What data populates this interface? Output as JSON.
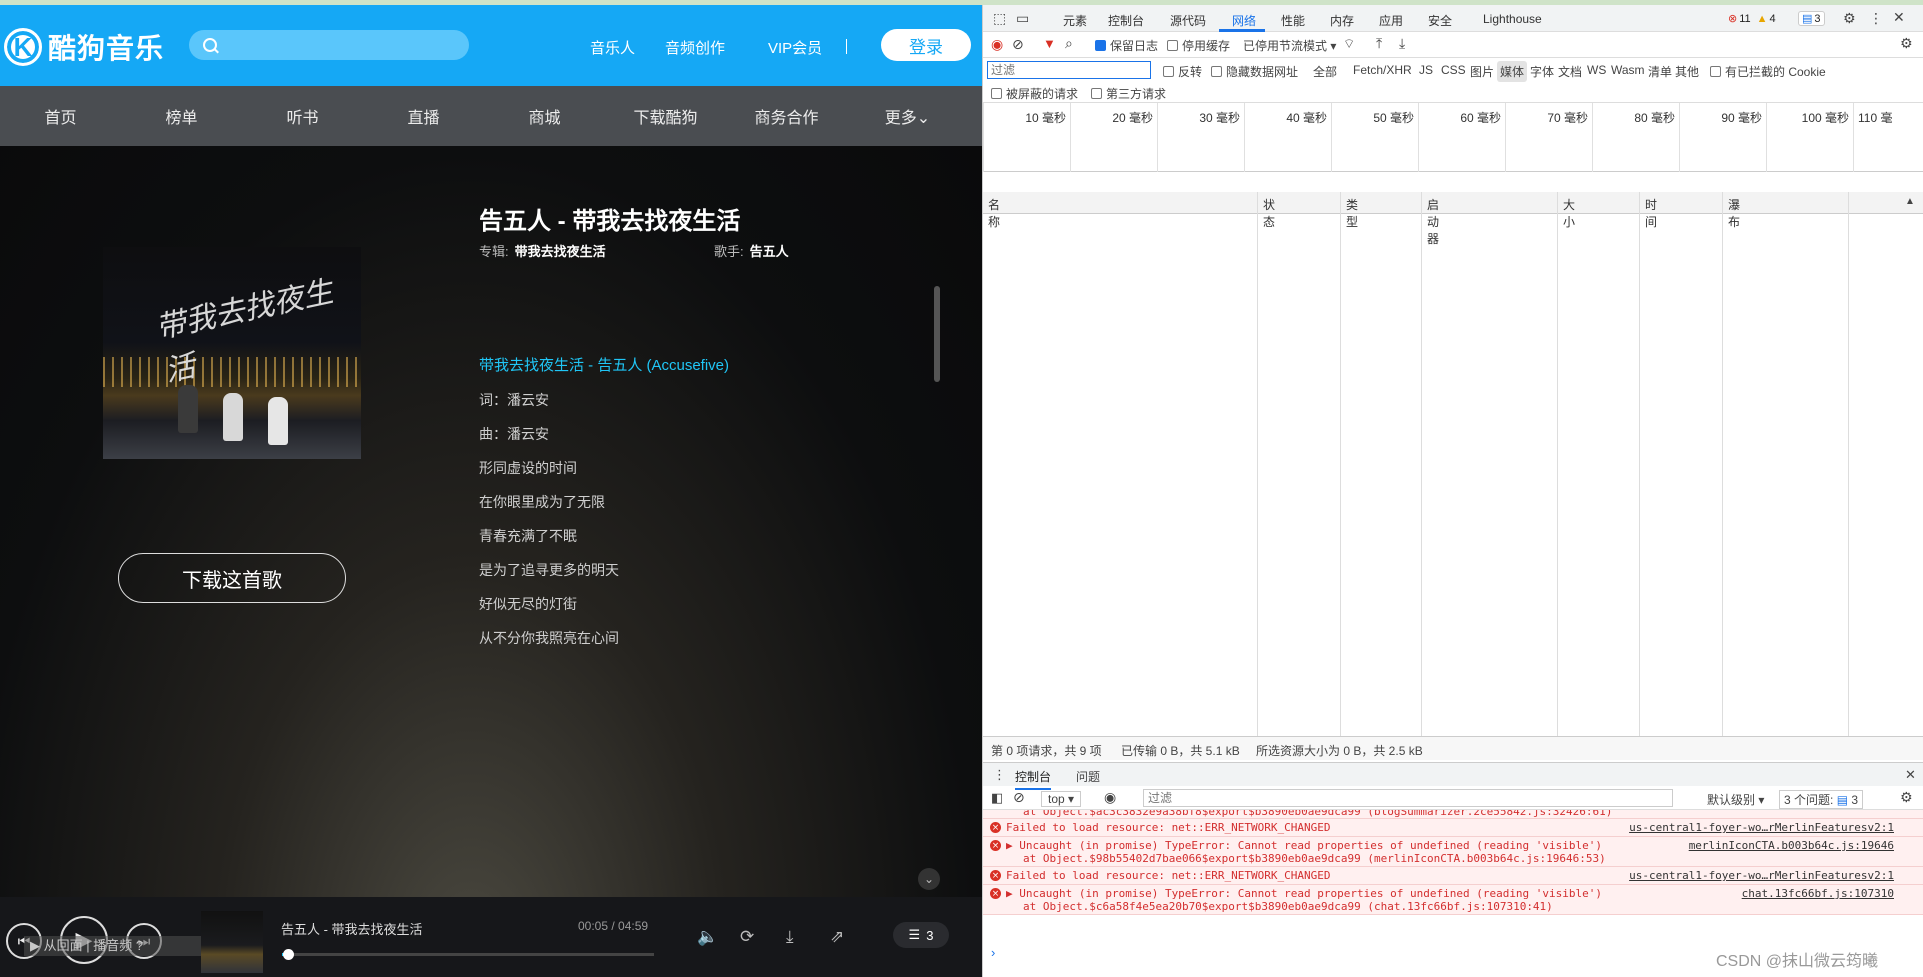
{
  "site": {
    "logo_letter": "K",
    "logo_text": "酷狗音乐",
    "header_links": [
      "音乐人",
      "音频创作",
      "VIP会员"
    ],
    "login_label": "登录",
    "nav": [
      "首页",
      "榜单",
      "听书",
      "直播",
      "商城",
      "下载酷狗",
      "商务合作",
      "更多⌄"
    ],
    "cover_title": "带我去找夜生活",
    "download_label": "下载这首歌",
    "song_title": "告五人 - 带我去找夜生活",
    "album_label": "专辑:",
    "album_value": "带我去找夜生活",
    "singer_label": "歌手:",
    "singer_value": "告五人",
    "lyrics": [
      "带我去找夜生活 - 告五人 (Accusefive)",
      "词：潘云安",
      "曲：潘云安",
      "形同虚设的时间",
      "在你眼里成为了无限",
      "青春充满了不眠",
      "是为了追寻更多的明天",
      "好似无尽的灯街",
      "从不分你我照亮在心间"
    ],
    "player": {
      "title": "告五人 - 带我去找夜生活",
      "time": "00:05 / 04:59",
      "progress": 0.017,
      "queue_count": "3",
      "overlay_text": "▶ 从回面 | 播音频   ?"
    }
  },
  "devtools": {
    "tabs": [
      "元素",
      "控制台",
      "源代码",
      "网络",
      "性能",
      "内存",
      "应用",
      "安全",
      "Lighthouse"
    ],
    "active_tab": "网络",
    "errors": "11",
    "warnings": "4",
    "messages": "3",
    "toolbar": {
      "preserve_log": "保留日志",
      "disable_cache": "停用缓存",
      "throttle": "已停用节流模式"
    },
    "filter_placeholder": "过滤",
    "filters": [
      "反转",
      "隐藏数据网址",
      "全部",
      "Fetch/XHR",
      "JS",
      "CSS",
      "图片",
      "媒体",
      "字体",
      "文档",
      "WS",
      "Wasm",
      "清单",
      "其他",
      "有已拦截的 Cookie"
    ],
    "filters2": [
      "被屏蔽的请求",
      "第三方请求"
    ],
    "timeline_ticks": [
      "10 毫秒",
      "20 毫秒",
      "30 毫秒",
      "40 毫秒",
      "50 毫秒",
      "60 毫秒",
      "70 毫秒",
      "80 毫秒",
      "90 毫秒",
      "100 毫秒",
      "110 毫"
    ],
    "columns": [
      "名称",
      "状态",
      "类型",
      "启动器",
      "大小",
      "时间",
      "瀑布"
    ],
    "summary": [
      "第 0 项请求，共 9 项",
      "已传输 0 B，共 5.1 kB",
      "所选资源大小为 0 B，共 2.5 kB"
    ],
    "console_tabs": [
      "控制台",
      "问题"
    ],
    "context": "top",
    "console_filter": "过滤",
    "level": "默认级别",
    "issues": "3 个问题:",
    "issues_count": "3",
    "logs": [
      {
        "msg": "",
        "sub": "at Object.$ac3c3832e9a38bf8$export$b3890eb0ae9dca99 (blogSummarizer.2ce55842.js:32426:61)",
        "src": "",
        "src2": ""
      },
      {
        "msg": "Failed to load resource: net::ERR_NETWORK_CHANGED",
        "sub": "",
        "src": "us-central1-foyer-wo…rMerlinFeaturesv2:1",
        "src2": ""
      },
      {
        "msg": "▶ Uncaught (in promise) TypeError: Cannot read properties of undefined (reading 'visible')",
        "sub": "at Object.$98b55402d7bae066$export$b3890eb0ae9dca99 (merlinIconCTA.b003b64c.js:19646:53)",
        "src": "merlinIconCTA.b003b64c.js:19646",
        "src2": ""
      },
      {
        "msg": "Failed to load resource: net::ERR_NETWORK_CHANGED",
        "sub": "",
        "src": "us-central1-foyer-wo…rMerlinFeaturesv2:1",
        "src2": ""
      },
      {
        "msg": "▶ Uncaught (in promise) TypeError: Cannot read properties of undefined (reading 'visible')",
        "sub": "at Object.$c6a58f4e5ea20b70$export$b3890eb0ae9dca99 (chat.13fc66bf.js:107310:41)",
        "src": "chat.13fc66bf.js:107310",
        "src2": ""
      }
    ],
    "prompt": "›"
  },
  "watermark": "CSDN @抹山微云筠曦"
}
